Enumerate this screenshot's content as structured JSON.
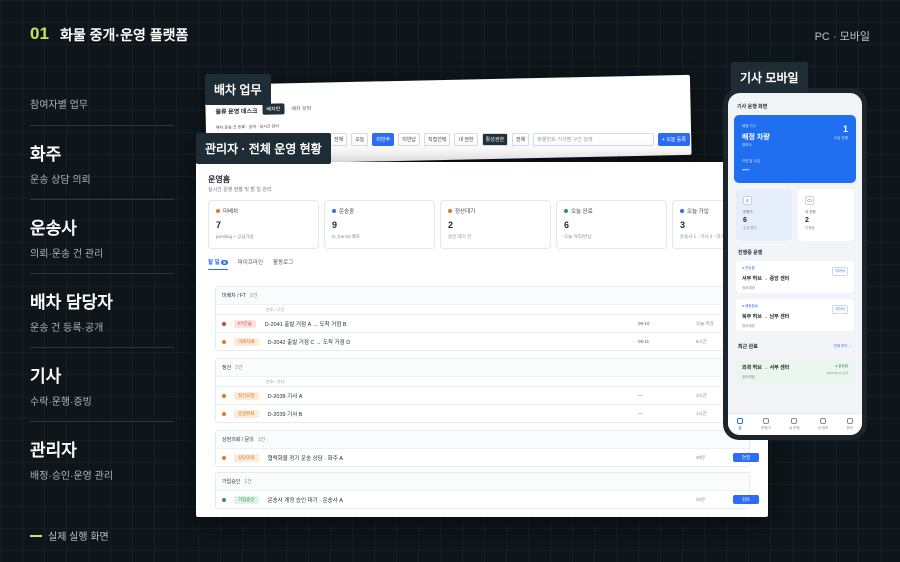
{
  "header": {
    "num": "01",
    "title": "화물 중개·운영 플랫폼",
    "right": "PC · 모바일"
  },
  "sidebar": {
    "caption": "참여자별 업무",
    "roles": [
      {
        "title": "화주",
        "desc": "운송 상담 의뢰"
      },
      {
        "title": "운송사",
        "desc": "의뢰·운송 건 관리"
      },
      {
        "title": "배차 담당자",
        "desc": "운송 건 등록·공개"
      },
      {
        "title": "기사",
        "desc": "수락·운행·증빙"
      },
      {
        "title": "관리자",
        "desc": "배정·승인·운영 관리"
      }
    ]
  },
  "footer": "실제 실행 화면",
  "tags": {
    "dispatch": "배차 업무",
    "admin": "관리자 · 전체 운영 현황",
    "driver": "기사 모바일"
  },
  "dispatch": {
    "title": "물류 운영 데스크",
    "tab1": "배차판",
    "tab2": "배차 상담",
    "sub": "배차 운송 건 등록 · 공개 · 실시간 관리"
  },
  "filters": {
    "items": [
      "전체",
      "오늘",
      "미반주",
      "미반납",
      "직접선택",
      "내 권한",
      "활성권한",
      "전체"
    ],
    "search": "화물번호·기사명·구간 검색",
    "add": "+ 오늘 등록"
  },
  "admin": {
    "title": "운영홈",
    "subtitle": "실시간 운영 현황 및 할 일 관리",
    "cards": [
      {
        "label": "미배차",
        "value": "7",
        "sub": "pending + 공급가용",
        "color": "#e8742c"
      },
      {
        "label": "운송중",
        "value": "9",
        "sub": "in_transit 배차",
        "color": "#2d6cf6"
      },
      {
        "label": "정산대기",
        "value": "2",
        "sub": "승인 대기 건",
        "color": "#e8742c"
      },
      {
        "label": "오늘 완료",
        "value": "6",
        "sub": "오늘 처리/반납",
        "color": "#2a9a55"
      },
      {
        "label": "오늘 가입",
        "value": "3",
        "sub": "운송사 1 · 기사 2 · 대기 1건",
        "color": "#2d6cf6"
      }
    ],
    "tabs": [
      "할 일",
      "파이프라인",
      "활동로그"
    ],
    "badge": "8"
  },
  "sections": [
    {
      "title": "미배차 / FT",
      "count": "2건",
      "colh": "번호 / 구간",
      "rows": [
        {
          "pill": "FT긴급",
          "pillbg": "#fde2e0",
          "pillfg": "#d93a2b",
          "dot": "#e23b2e",
          "text": "D-2041 출발 거점 A → 도착 거점 B",
          "date": "09-10",
          "stat": "오늘 마감"
        },
        {
          "pill": "미배차배",
          "pillbg": "#fdebd9",
          "pillfg": "#d8731f",
          "dot": "#e8742c",
          "text": "D-2042 출발 거점 C → 도착 거점 D",
          "date": "09-11",
          "stat": "8시간"
        }
      ]
    },
    {
      "title": "정산",
      "count": "2건",
      "colh": "번호 / 기사",
      "rows": [
        {
          "pill": "정산요청",
          "pillbg": "#fdebd9",
          "pillfg": "#d8731f",
          "dot": "#e8742c",
          "text": "D-2038 기사 A",
          "date": "—",
          "stat": "2시간"
        },
        {
          "pill": "증빙완료",
          "pillbg": "#fdebd9",
          "pillfg": "#d8731f",
          "dot": "#e8742c",
          "text": "D-2039 기사 B",
          "date": "—",
          "stat": "1시간"
        }
      ]
    },
    {
      "title": "상담의뢰 / 문의",
      "count": "1건",
      "rows": [
        {
          "pill": "상담의뢰",
          "pillbg": "#fdebd9",
          "pillfg": "#d8731f",
          "dot": "#e8742c",
          "text": "협력화물 정기 운송 상담 · 화주 A",
          "stat": "30분",
          "btn": "연결"
        }
      ]
    },
    {
      "title": "가입승인",
      "count": "1건",
      "rows": [
        {
          "pill": "가입승인",
          "pillbg": "#dff3e6",
          "pillfg": "#2a8a4a",
          "dot": "#2a9a55",
          "text": "운송사 계정 승인 대기 · 운송사 A",
          "stat": "20분",
          "btn": "검토"
        }
      ]
    }
  ],
  "phone": {
    "header": "기사 운행 화면",
    "blue": {
      "a": "배정 기사",
      "b": "배정 차량",
      "c": "협력사",
      "d": "1",
      "e": "오늘 운행",
      "f": "이번 달 수입",
      "g": "—"
    },
    "mini": [
      {
        "label": "운행가",
        "value": "6",
        "sub": "수금 확인",
        "icon": "⌕"
      },
      {
        "label": "내 운행",
        "value": "2",
        "sub": "진행중",
        "icon": "▭"
      }
    ],
    "section1": "진행중 운행",
    "jobs": [
      {
        "tag": "● 운송중",
        "route": "서부 허브 → 중앙 센터",
        "sub": "정비예정",
        "link": "이어서"
      },
      {
        "tag": "● 배정완료",
        "route": "북부 허브 → 남부 센터",
        "sub": "정비예정",
        "link": "이어서"
      }
    ],
    "section2": "최근 완료",
    "more": "전체 보기 →",
    "done": {
      "route": "외곽 허브 → 서부 센터",
      "sub": "정비예정",
      "stat": "● 완료됨",
      "date": "2025.09.12 도착"
    },
    "nav": [
      "홈",
      "운행가",
      "내 운행",
      "내 정보",
      "문의"
    ]
  }
}
